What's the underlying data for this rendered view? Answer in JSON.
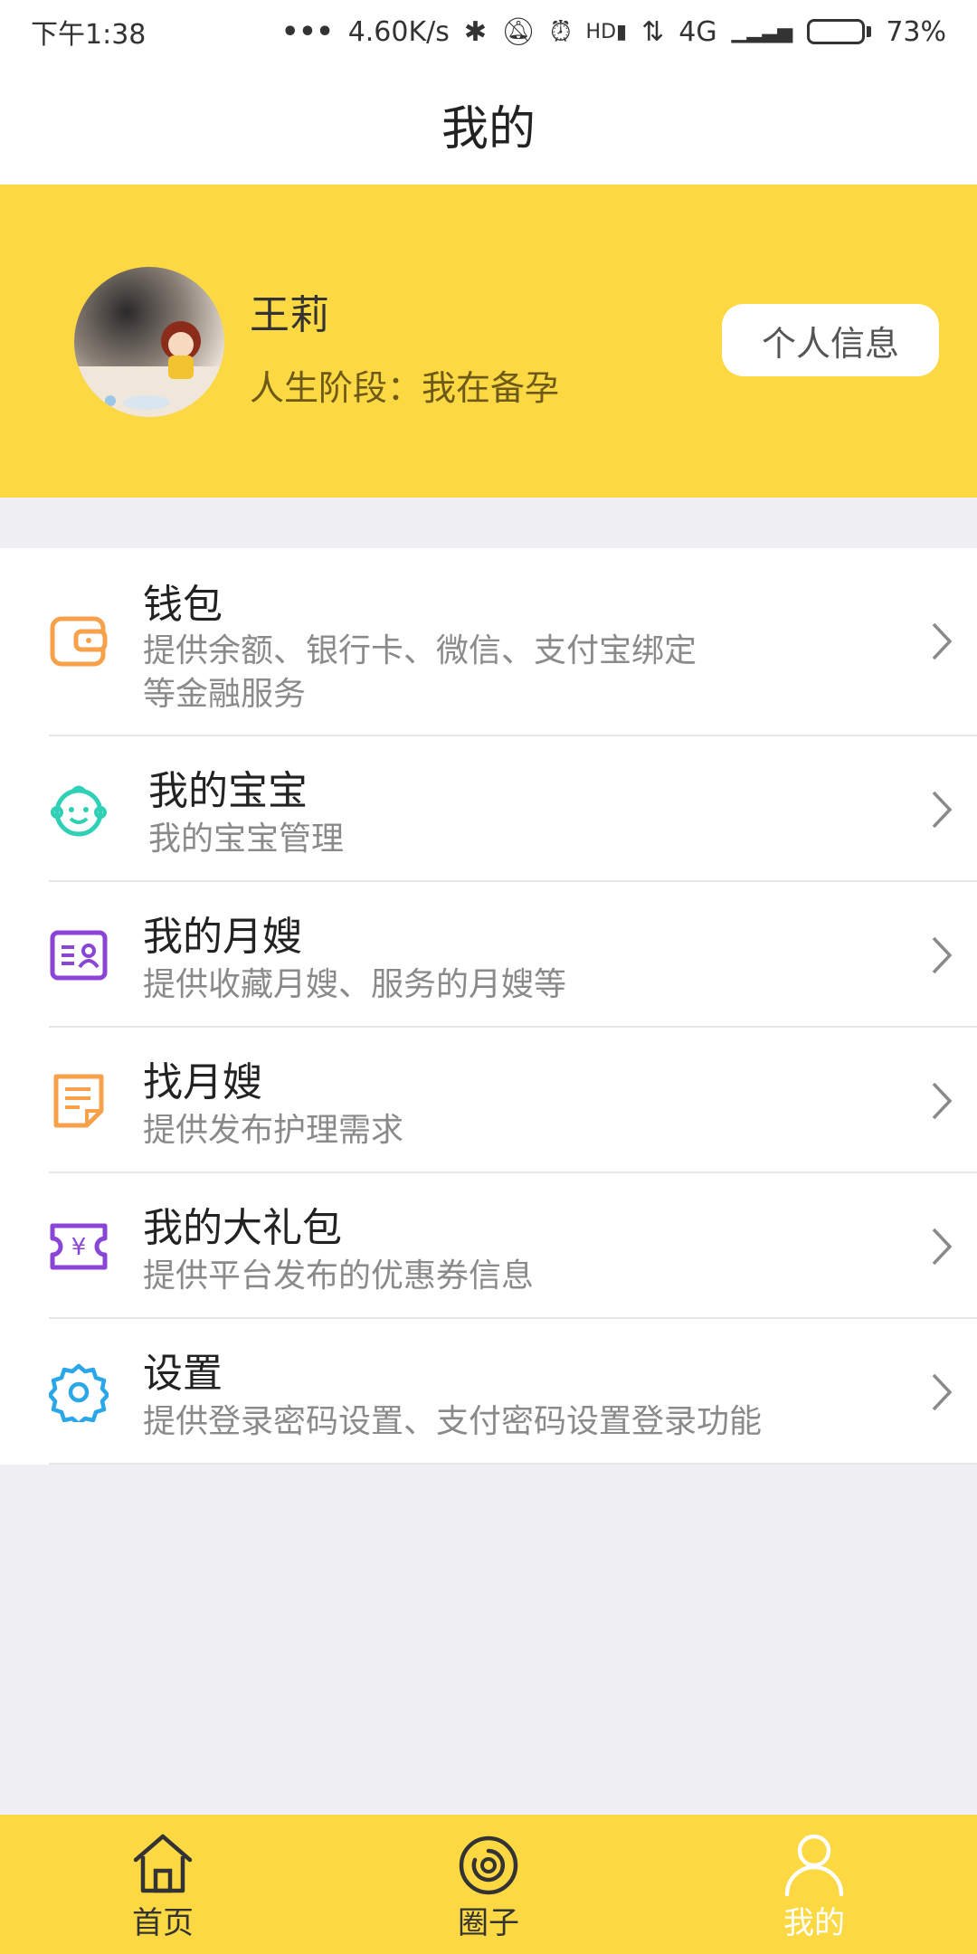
{
  "status_bar": {
    "time": "下午1:38",
    "speed": "4.60K/s",
    "network": "4G",
    "battery": "73%",
    "battery_level": 0.73
  },
  "header": {
    "title": "我的"
  },
  "profile": {
    "name": "王莉",
    "stage": "人生阶段：我在备孕",
    "info_button": "个人信息"
  },
  "menu": [
    {
      "title": "钱包",
      "subtitle_line1": "提供余额、银行卡、微信、支付宝绑定",
      "subtitle_line2": "等金融服务",
      "icon": "wallet-icon",
      "color": "#f7a24a"
    },
    {
      "title": "我的宝宝",
      "subtitle": "我的宝宝管理",
      "icon": "baby-face-icon",
      "color": "#2fd0b5"
    },
    {
      "title": "我的月嫂",
      "subtitle": "提供收藏月嫂、服务的月嫂等",
      "icon": "id-card-icon",
      "color": "#8a45d6"
    },
    {
      "title": "找月嫂",
      "subtitle": "提供发布护理需求",
      "icon": "document-icon",
      "color": "#f7a24a"
    },
    {
      "title": "我的大礼包",
      "subtitle": "提供平台发布的优惠券信息",
      "icon": "coupon-icon",
      "color": "#8a45d6"
    },
    {
      "title": "设置",
      "subtitle": "提供登录密码设置、支付密码设置登录功能",
      "icon": "gear-icon",
      "color": "#2aa7e8"
    }
  ],
  "tabs": [
    {
      "label": "首页",
      "icon": "home-icon"
    },
    {
      "label": "圈子",
      "icon": "circle-icon"
    },
    {
      "label": "我的",
      "icon": "person-icon",
      "active": true
    }
  ],
  "colors": {
    "accent": "#fcd843",
    "background": "#efeff4"
  }
}
